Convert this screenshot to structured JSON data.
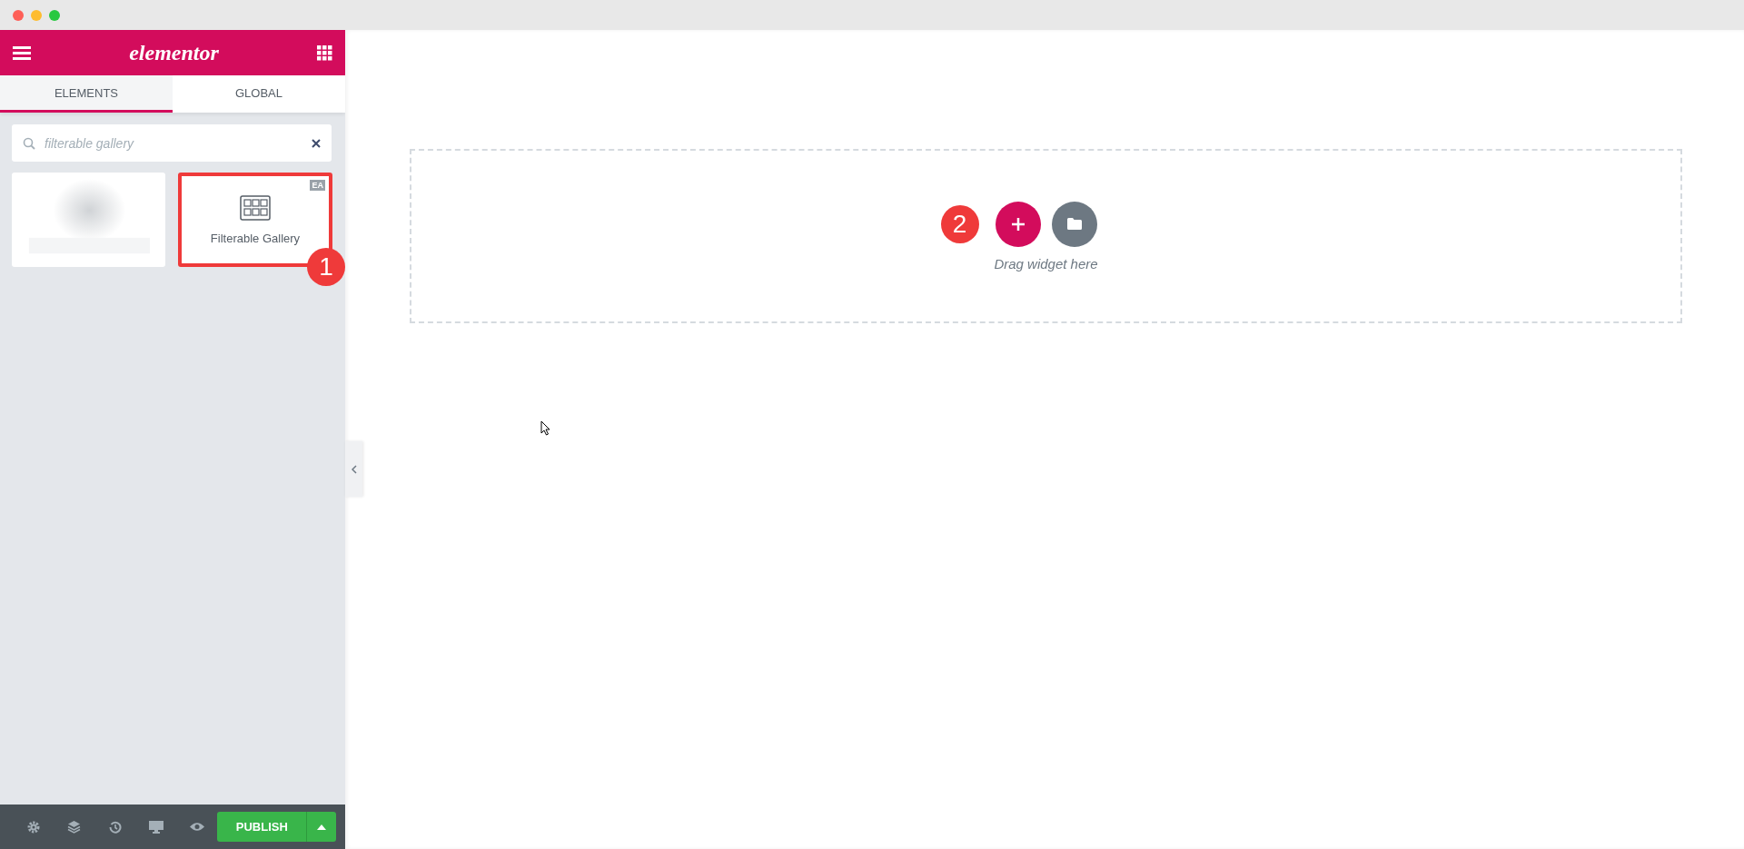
{
  "header": {
    "logo": "elementor"
  },
  "tabs": [
    {
      "label": "ELEMENTS",
      "selected": true
    },
    {
      "label": "GLOBAL",
      "selected": false
    }
  ],
  "search": {
    "placeholder": "filterable gallery"
  },
  "widgets": [
    {
      "kind": "blurred",
      "highlighted": false
    },
    {
      "kind": "widget",
      "label": "Filterable Gallery",
      "badge": "EA",
      "highlighted": true,
      "step": "1"
    }
  ],
  "footer": {
    "publish": "PUBLISH"
  },
  "canvas": {
    "step": "2",
    "hint": "Drag widget here"
  }
}
